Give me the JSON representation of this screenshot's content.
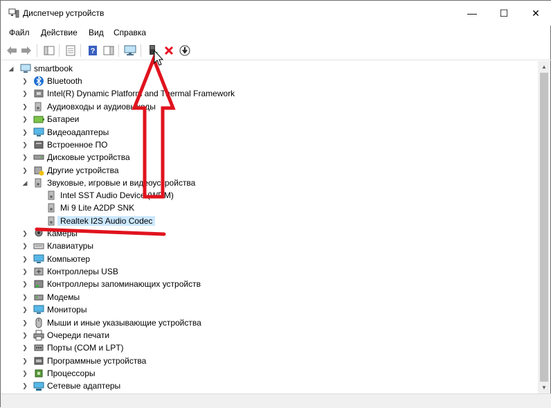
{
  "window": {
    "title": "Диспетчер устройств",
    "controls": {
      "minimize": "—",
      "maximize": "☐",
      "close": "✕"
    }
  },
  "menu": [
    "Файл",
    "Действие",
    "Вид",
    "Справка"
  ],
  "toolbar": {
    "buttons": [
      "back-icon",
      "forward-icon",
      "console-tree-icon",
      "properties-icon",
      "help-icon",
      "action-pane-icon",
      "monitor-icon",
      "update-driver-icon",
      "uninstall-icon",
      "download-icon"
    ],
    "accent_red": "#e81123",
    "annotation_color": "#e0131e"
  },
  "tree": {
    "root": "smartbook",
    "items": [
      {
        "label": "Bluetooth",
        "icon": "bluetooth-icon"
      },
      {
        "label": "Intel(R) Dynamic Platform and Thermal Framework",
        "icon": "chip-icon"
      },
      {
        "label": "Аудиовходы и аудиовыходы",
        "icon": "speaker-icon"
      },
      {
        "label": "Батареи",
        "icon": "battery-icon"
      },
      {
        "label": "Видеоадаптеры",
        "icon": "display-adapter-icon"
      },
      {
        "label": "Встроенное ПО",
        "icon": "firmware-icon"
      },
      {
        "label": "Дисковые устройства",
        "icon": "disk-icon"
      },
      {
        "label": "Другие устройства",
        "icon": "unknown-device-icon"
      },
      {
        "label": "Звуковые, игровые и видеоустройства",
        "icon": "speaker-icon",
        "expanded": true,
        "children": [
          {
            "label": "Intel SST Audio Device (WDM)"
          },
          {
            "label": "Mi 9 Lite A2DP SNK"
          },
          {
            "label": "Realtek I2S Audio Codec",
            "selected": true
          }
        ]
      },
      {
        "label": "Камеры",
        "icon": "camera-icon"
      },
      {
        "label": "Клавиатуры",
        "icon": "keyboard-icon"
      },
      {
        "label": "Компьютер",
        "icon": "computer-icon"
      },
      {
        "label": "Контроллеры USB",
        "icon": "usb-icon"
      },
      {
        "label": "Контроллеры запоминающих устройств",
        "icon": "storage-controller-icon"
      },
      {
        "label": "Модемы",
        "icon": "modem-icon"
      },
      {
        "label": "Мониторы",
        "icon": "monitor-icon"
      },
      {
        "label": "Мыши и иные указывающие устройства",
        "icon": "mouse-icon"
      },
      {
        "label": "Очереди печати",
        "icon": "printer-icon"
      },
      {
        "label": "Порты (COM и LPT)",
        "icon": "port-icon"
      },
      {
        "label": "Программные устройства",
        "icon": "software-device-icon"
      },
      {
        "label": "Процессоры",
        "icon": "processor-icon"
      },
      {
        "label": "Сетевые адаптеры",
        "icon": "network-adapter-icon"
      }
    ]
  }
}
